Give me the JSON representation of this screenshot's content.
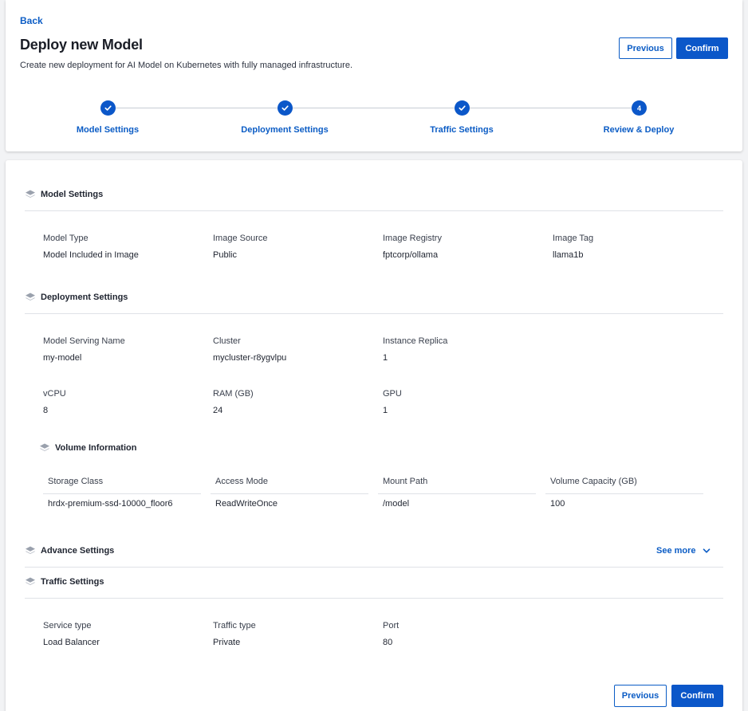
{
  "header": {
    "back_label": "Back",
    "title": "Deploy new Model",
    "subtitle": "Create new deployment for AI Model on Kubernetes with fully managed infrastructure.",
    "previous_label": "Previous",
    "confirm_label": "Confirm"
  },
  "stepper": {
    "steps": [
      {
        "label": "Model Settings",
        "state": "done"
      },
      {
        "label": "Deployment Settings",
        "state": "done"
      },
      {
        "label": "Traffic Settings",
        "state": "done"
      },
      {
        "label": "Review & Deploy",
        "state": "active",
        "number": "4"
      }
    ]
  },
  "model_settings": {
    "title": "Model Settings",
    "fields": [
      {
        "label": "Model Type",
        "value": "Model Included in Image"
      },
      {
        "label": "Image Source",
        "value": "Public"
      },
      {
        "label": "Image Registry",
        "value": "fptcorp/ollama"
      },
      {
        "label": "Image Tag",
        "value": "llama1b"
      }
    ]
  },
  "deployment_settings": {
    "title": "Deployment Settings",
    "fields": [
      {
        "label": "Model Serving Name",
        "value": "my-model"
      },
      {
        "label": "Cluster",
        "value": "mycluster-r8ygvlpu"
      },
      {
        "label": "Instance Replica",
        "value": "1"
      },
      {
        "label": "vCPU",
        "value": "8"
      },
      {
        "label": "RAM (GB)",
        "value": "24"
      },
      {
        "label": "GPU",
        "value": "1"
      }
    ]
  },
  "volume_information": {
    "title": "Volume Information",
    "columns": [
      "Storage Class",
      "Access Mode",
      "Mount Path",
      "Volume Capacity (GB)"
    ],
    "rows": [
      [
        "hrdx-premium-ssd-10000_floor6",
        "ReadWriteOnce",
        "/model",
        "100"
      ]
    ]
  },
  "advance_settings": {
    "title": "Advance Settings",
    "see_more_label": "See more"
  },
  "traffic_settings": {
    "title": "Traffic Settings",
    "fields": [
      {
        "label": "Service type",
        "value": "Load Balancer"
      },
      {
        "label": "Traffic type",
        "value": "Private"
      },
      {
        "label": "Port",
        "value": "80"
      }
    ]
  },
  "footer": {
    "previous_label": "Previous",
    "confirm_label": "Confirm"
  },
  "colors": {
    "accent": "#0b57c9",
    "link": "#0b5cc5",
    "background": "#f2f3f5"
  }
}
